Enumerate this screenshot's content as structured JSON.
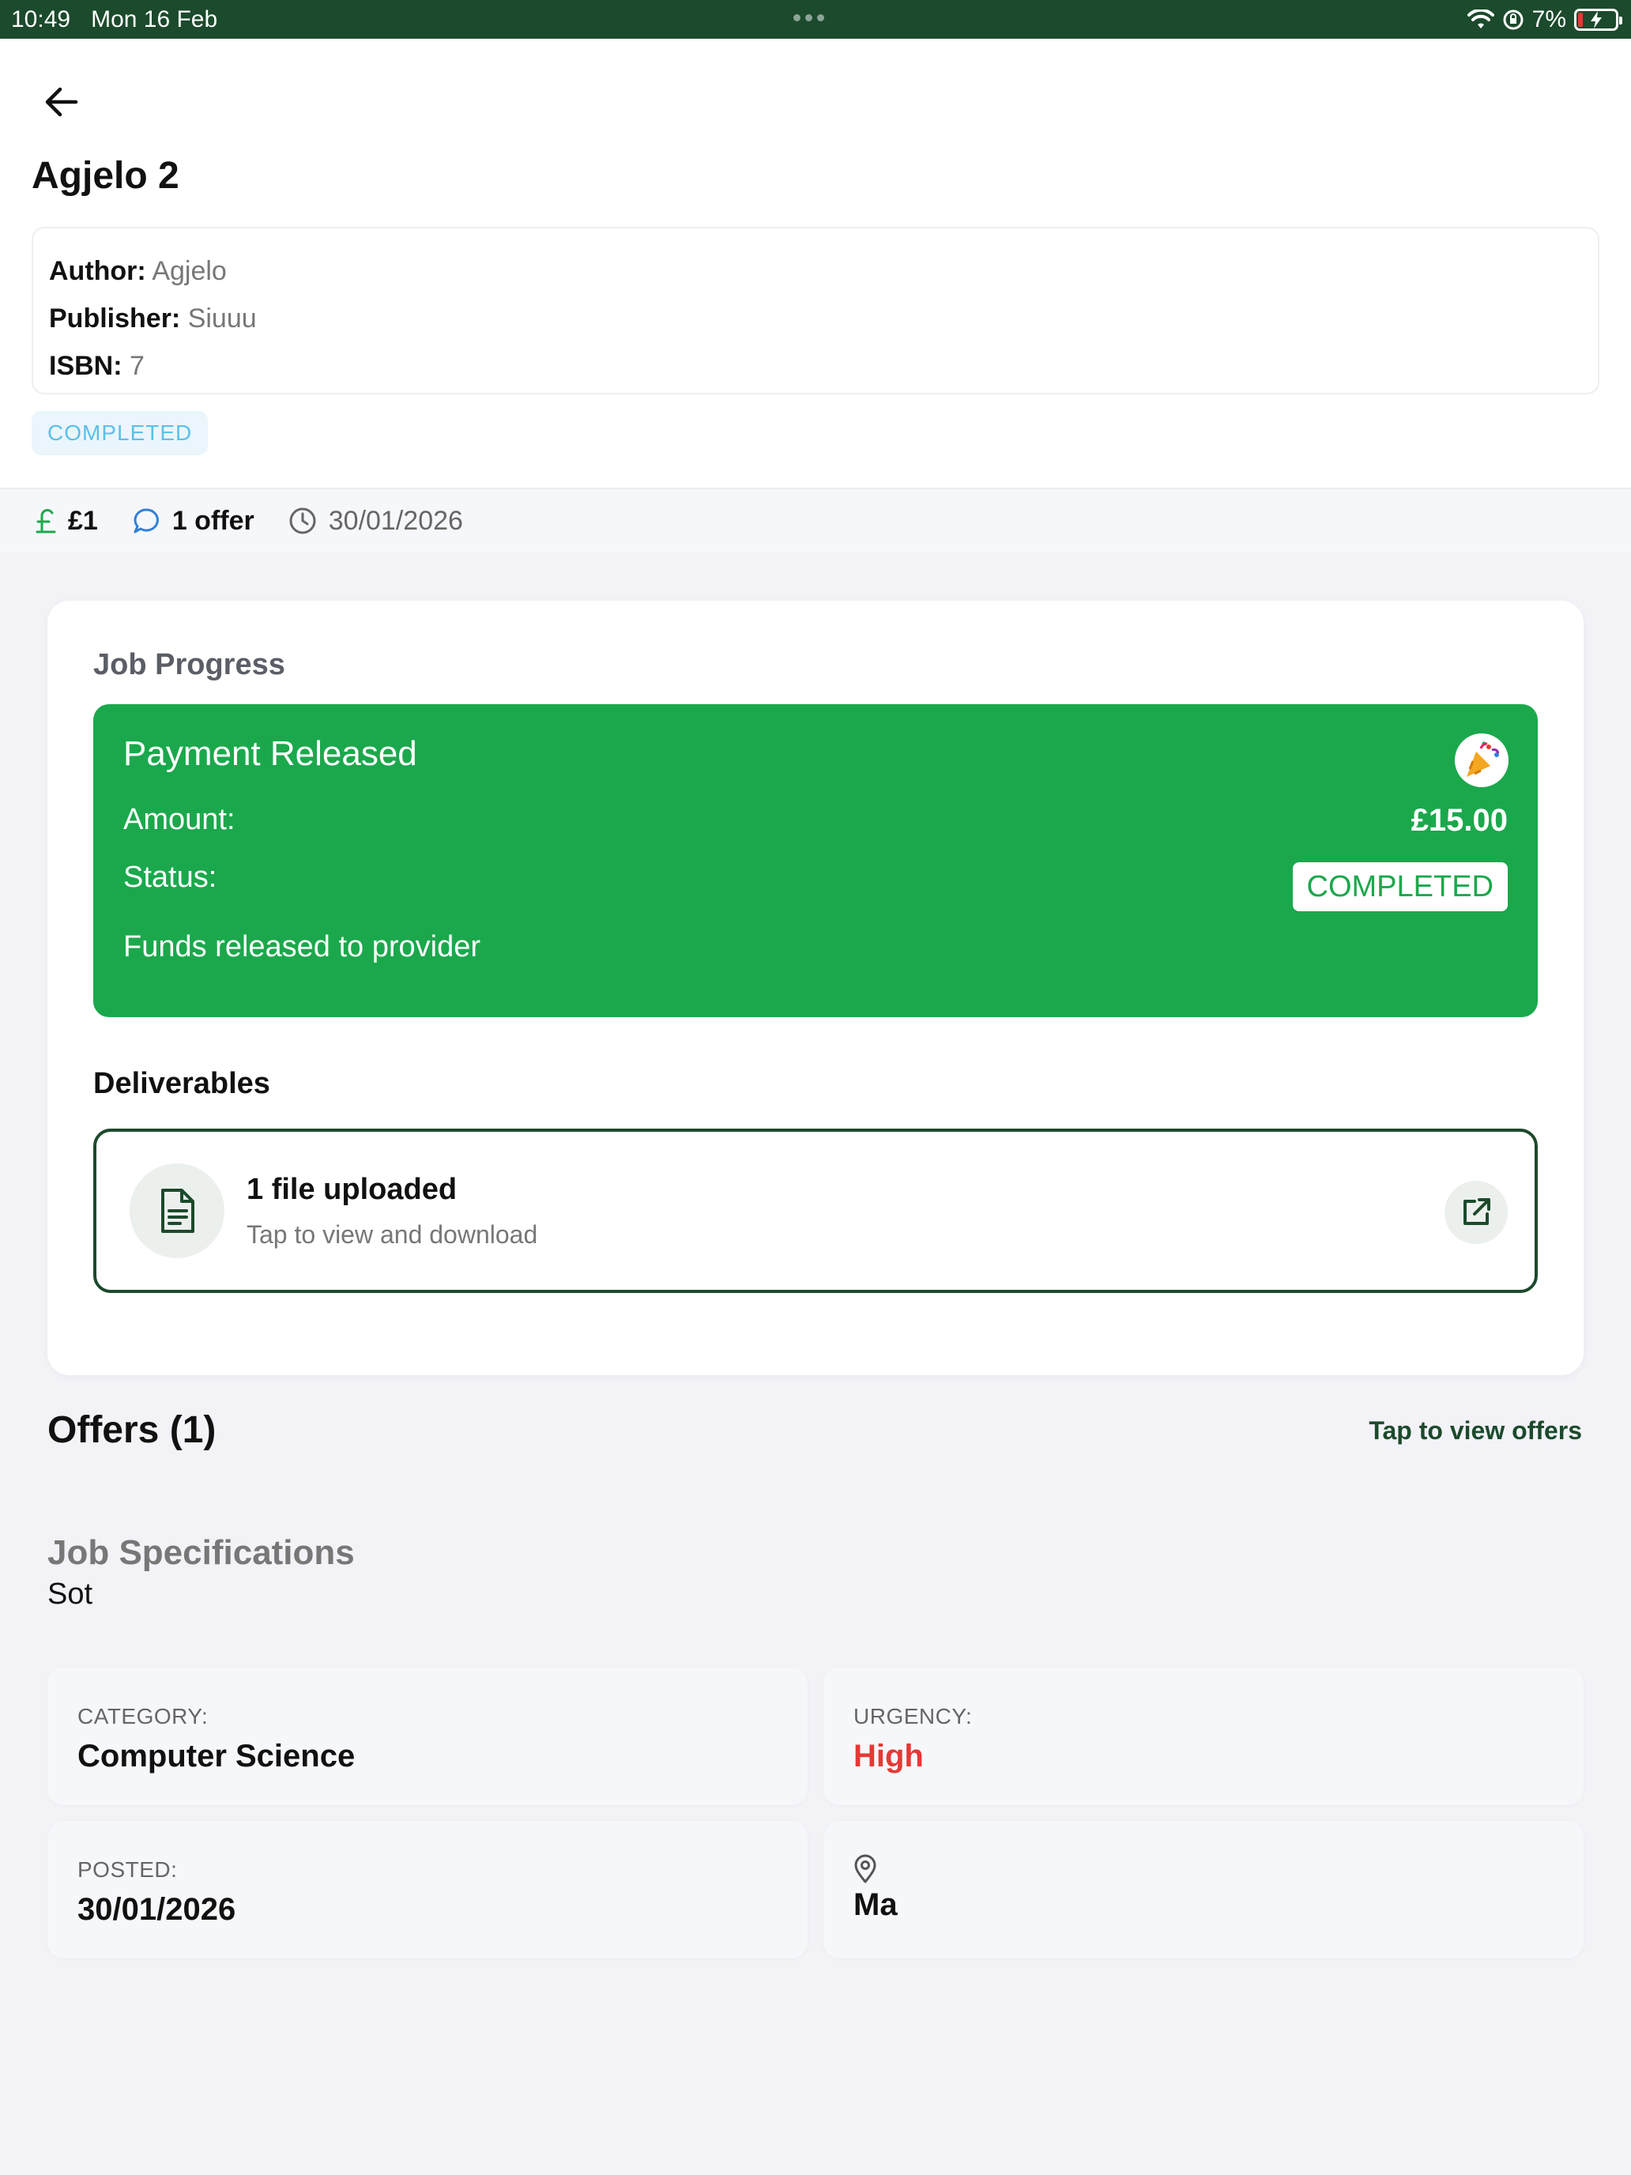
{
  "status_bar": {
    "time": "10:49",
    "date": "Mon 16 Feb",
    "battery": "7%"
  },
  "header": {
    "title": "Agjelo 2",
    "author_label": "Author:",
    "author_value": "Agjelo",
    "publisher_label": "Publisher:",
    "publisher_value": "Siuuu",
    "isbn_label": "ISBN:",
    "isbn_value": "7",
    "status": "COMPLETED"
  },
  "stats": {
    "price": "£1",
    "offers": "1 offer",
    "date": "30/01/2026"
  },
  "progress": {
    "section_label": "Job Progress",
    "payment_title": "Payment Released",
    "amount_label": "Amount:",
    "amount_value": "£15.00",
    "status_label": "Status:",
    "status_value": "COMPLETED",
    "note": "Funds released to provider",
    "deliverables_title": "Deliverables",
    "deliverable_main": "1 file uploaded",
    "deliverable_sub": "Tap to view and download"
  },
  "offers": {
    "title": "Offers (1)",
    "link": "Tap to view offers"
  },
  "specs": {
    "title": "Job Specifications",
    "text": "Sot",
    "category_label": "CATEGORY:",
    "category_value": "Computer Science",
    "urgency_label": "URGENCY:",
    "urgency_value": "High",
    "posted_label": "POSTED:",
    "posted_value": "30/01/2026",
    "location_value": "Ma"
  },
  "colors": {
    "brand_dark": "#1c4a2c",
    "success": "#1ba84c",
    "urgent": "#e53935",
    "info": "#5bc1ea"
  }
}
